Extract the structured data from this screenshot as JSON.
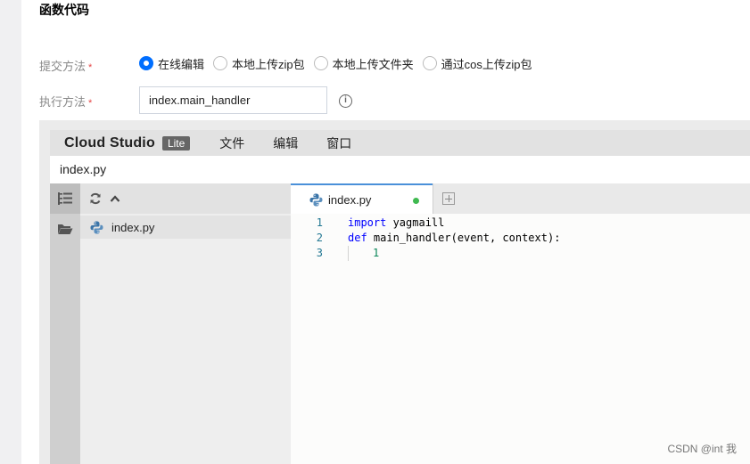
{
  "section": {
    "title": "函数代码"
  },
  "form": {
    "submit_label": "提交方法",
    "submit_required": "*",
    "options": [
      "在线编辑",
      "本地上传zip包",
      "本地上传文件夹",
      "通过cos上传zip包"
    ],
    "handler_label": "执行方法",
    "handler_required": "*",
    "handler_value": "index.main_handler",
    "info_glyph": "i"
  },
  "ide": {
    "brand": "Cloud Studio",
    "badge": "Lite",
    "menu": [
      "文件",
      "编辑",
      "窗口"
    ],
    "current_file": "index.py",
    "explorer_file": "index.py",
    "tab_label": "index.py",
    "tab_modified_color": "#3fb950",
    "code_lines": [
      {
        "n": "1",
        "kw": "import",
        "text": " yagmaill"
      },
      {
        "n": "2",
        "kw": "def",
        "text": " main_handler(event, context):"
      },
      {
        "n": "3",
        "kw": "",
        "text": "1"
      }
    ]
  },
  "watermark": "CSDN @int 我",
  "colors": {
    "accent": "#006eff",
    "required": "#e54545",
    "keyword": "#0000ff",
    "line_number": "#237893"
  }
}
